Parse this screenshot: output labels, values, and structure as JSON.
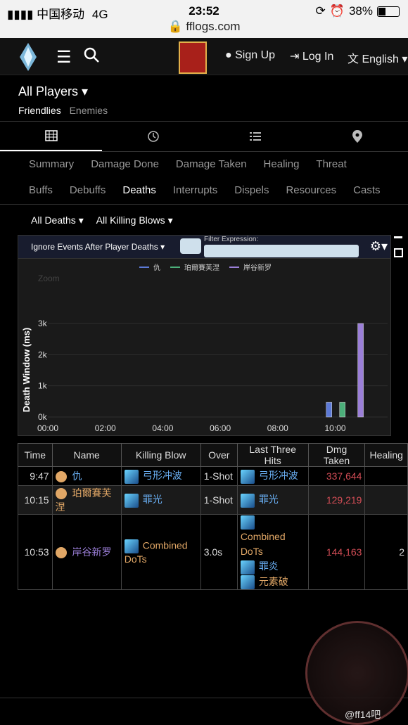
{
  "status": {
    "carrier": "中国移动",
    "network": "4G",
    "time": "23:52",
    "battery": "38%",
    "url": "fflogs.com"
  },
  "nav": {
    "signup": "Sign Up",
    "login": "Log In",
    "language": "English"
  },
  "players": {
    "label": "All Players",
    "friendlies": "Friendlies",
    "enemies": "Enemies"
  },
  "view_icons": [
    "table-icon",
    "clock-icon",
    "list-icon",
    "location-icon"
  ],
  "tabs_row1": [
    "Summary",
    "Damage Done",
    "Damage Taken",
    "Healing",
    "Threat"
  ],
  "tabs_row2": [
    "Buffs",
    "Debuffs",
    "Deaths",
    "Interrupts",
    "Dispels",
    "Resources",
    "Casts"
  ],
  "active_tab": "Deaths",
  "filters": {
    "deaths": "All Deaths",
    "killing": "All Killing Blows"
  },
  "chart_controls": {
    "ignore": "Ignore Events After Player Deaths",
    "filter_label": "Filter Expression:",
    "zoom": "Zoom"
  },
  "chart_data": {
    "type": "bar",
    "ylabel": "Death Window (ms)",
    "yticks": [
      "0k",
      "1k",
      "2k",
      "3k"
    ],
    "xticks": [
      "00:00",
      "02:00",
      "04:00",
      "06:00",
      "08:00",
      "10:00"
    ],
    "xlim_seconds": [
      0,
      680
    ],
    "ylim": [
      0,
      3000
    ],
    "series": [
      {
        "name": "仇",
        "color": "#5c79d6",
        "x_seconds": 587,
        "value": 470
      },
      {
        "name": "珀爾賽芙涅",
        "color": "#4caf7a",
        "x_seconds": 615,
        "value": 470
      },
      {
        "name": "岸谷新罗",
        "color": "#9b7fd8",
        "x_seconds": 653,
        "value": 3000
      }
    ]
  },
  "table": {
    "headers": [
      "Time",
      "Name",
      "Killing Blow",
      "Over",
      "Last Three Hits",
      "Dmg Taken",
      "Healing"
    ],
    "rows": [
      {
        "time": "9:47",
        "name": "仇",
        "killing": "弓形冲波",
        "over": "1-Shot",
        "hits": [
          "弓形冲波"
        ],
        "dmg": "337,644",
        "name_color": "#6ab0f5",
        "cls_color": "#e1a766"
      },
      {
        "time": "10:15",
        "name": "珀爾賽芙涅",
        "killing": "罪光",
        "over": "1-Shot",
        "hits": [
          "罪光"
        ],
        "dmg": "129,219",
        "name_color": "#e1a766",
        "cls_color": "#e1a766"
      },
      {
        "time": "10:53",
        "name": "岸谷新罗",
        "killing": "Combined DoTs",
        "over": "3.0s",
        "hits": [
          "Combined DoTs",
          "罪炎",
          "元素破"
        ],
        "dmg": "144,163",
        "name_color": "#9b7fd8",
        "cls_color": "#e1a766",
        "healing": "2"
      }
    ]
  },
  "watermark": {
    "text": "@ff14吧"
  }
}
